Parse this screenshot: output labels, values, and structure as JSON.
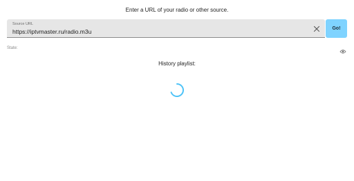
{
  "header": {
    "prompt": "Enter a URL of your radio or other source."
  },
  "source": {
    "label": "Source URL",
    "value": "https://iptvmaster.ru/radio.m3u",
    "go_label": "Go!"
  },
  "state": {
    "label": "State:"
  },
  "history": {
    "title": "History playlist:"
  },
  "icons": {
    "clear": "close-icon",
    "visibility": "eye-icon",
    "loading": "spinner-icon"
  },
  "colors": {
    "accent": "#7fd3ff",
    "spinner": "#4fc3f7",
    "field_bg": "#e6e6e6"
  }
}
